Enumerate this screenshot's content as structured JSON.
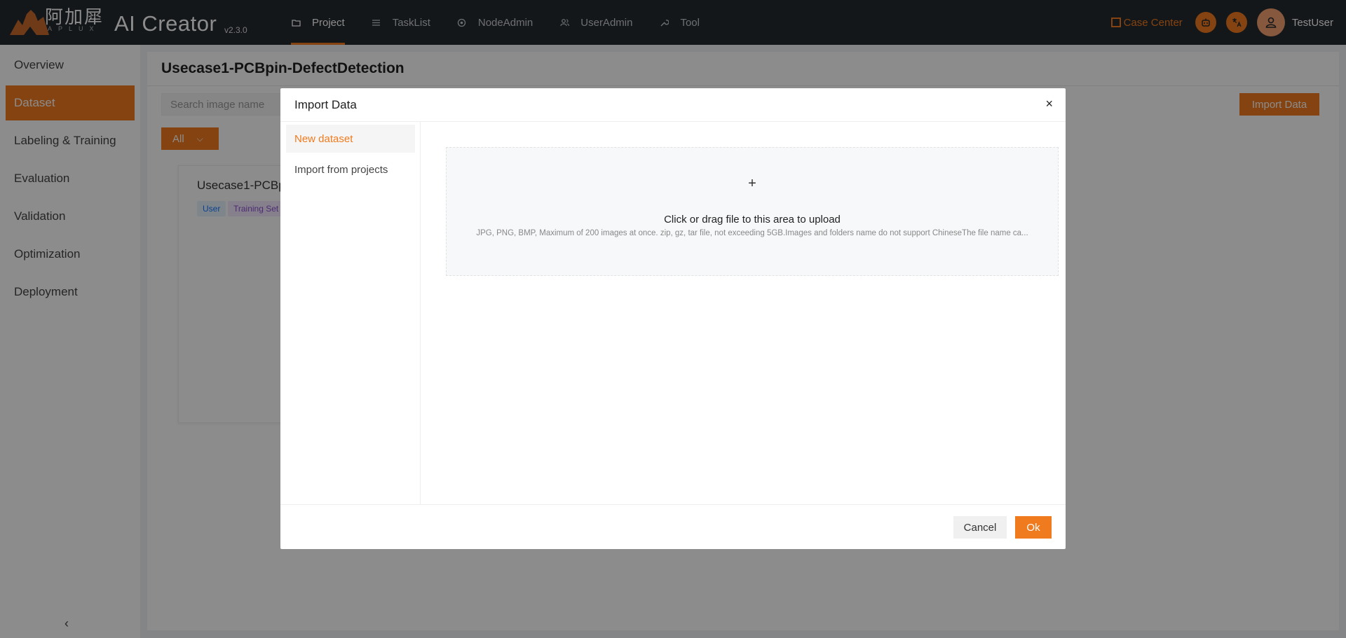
{
  "header": {
    "logo_cn": "阿加犀",
    "logo_sub": "APLUX",
    "app_title": "AI Creator",
    "version": "v2.3.0",
    "nav": [
      {
        "label": "Project",
        "icon": "folder-icon"
      },
      {
        "label": "TaskList",
        "icon": "list-icon"
      },
      {
        "label": "NodeAdmin",
        "icon": "node-icon"
      },
      {
        "label": "UserAdmin",
        "icon": "users-icon"
      },
      {
        "label": "Tool",
        "icon": "wrench-icon"
      }
    ],
    "case_center": "Case Center",
    "username": "TestUser"
  },
  "sidebar": {
    "items": [
      {
        "label": "Overview"
      },
      {
        "label": "Dataset"
      },
      {
        "label": "Labeling & Training"
      },
      {
        "label": "Evaluation"
      },
      {
        "label": "Validation"
      },
      {
        "label": "Optimization"
      },
      {
        "label": "Deployment"
      }
    ],
    "active": "Dataset"
  },
  "main": {
    "title": "Usecase1-PCBpin-DefectDetection",
    "search_placeholder": "Search image name",
    "filter_label": "All",
    "import_label": "Import Data",
    "card": {
      "title": "Usecase1-PCBpin",
      "tags": [
        "User",
        "Training Set"
      ]
    }
  },
  "modal": {
    "title": "Import Data",
    "tabs": [
      {
        "label": "New dataset"
      },
      {
        "label": "Import from projects"
      }
    ],
    "upload_text": "Click or drag file to this area to upload",
    "upload_hint": "JPG, PNG, BMP, Maximum of 200 images at once. zip, gz, tar file, not exceeding 5GB.Images and folders name do not support ChineseThe file name ca...",
    "cancel_label": "Cancel",
    "ok_label": "Ok"
  },
  "colors": {
    "accent": "#f07b1e",
    "topbar": "#262b31"
  }
}
